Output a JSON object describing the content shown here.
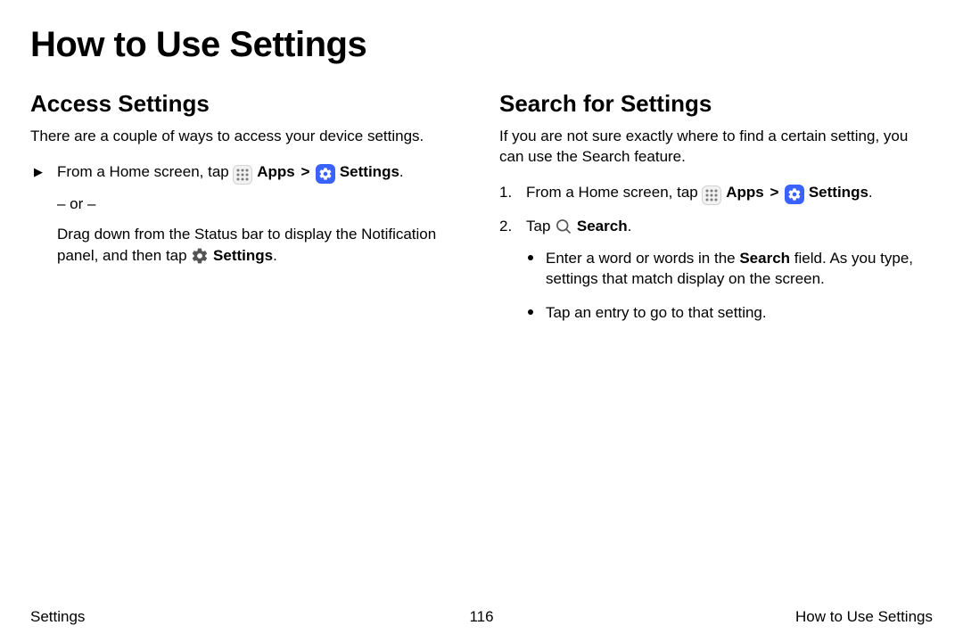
{
  "page_title": "How to Use Settings",
  "left": {
    "heading": "Access Settings",
    "intro": "There are a couple of ways to access your device settings.",
    "step_lead": "From a Home screen, tap ",
    "apps_label": "Apps",
    "settings_label": "Settings",
    "period": ".",
    "or_text": "– or –",
    "drag_text_a": "Drag down from the Status bar to display the Notification panel, and then tap ",
    "drag_settings": "Settings",
    "drag_text_b": "."
  },
  "right": {
    "heading": "Search for Settings",
    "intro": "If you are not sure exactly where to find a certain setting, you can use the Search feature.",
    "step1_num": "1.",
    "step1_lead": "From a Home screen, tap ",
    "apps_label": "Apps",
    "settings_label": "Settings",
    "period": ".",
    "step2_num": "2.",
    "step2_lead": "Tap ",
    "search_label": "Search",
    "bullet1_a": "Enter a word or words in the ",
    "bullet1_bold": "Search",
    "bullet1_b": " field. As you type, settings that match display on the screen.",
    "bullet2": "Tap an entry to go to that setting."
  },
  "footer": {
    "left": "Settings",
    "center": "116",
    "right": "How to Use Settings"
  },
  "symbols": {
    "chevron": ">"
  }
}
